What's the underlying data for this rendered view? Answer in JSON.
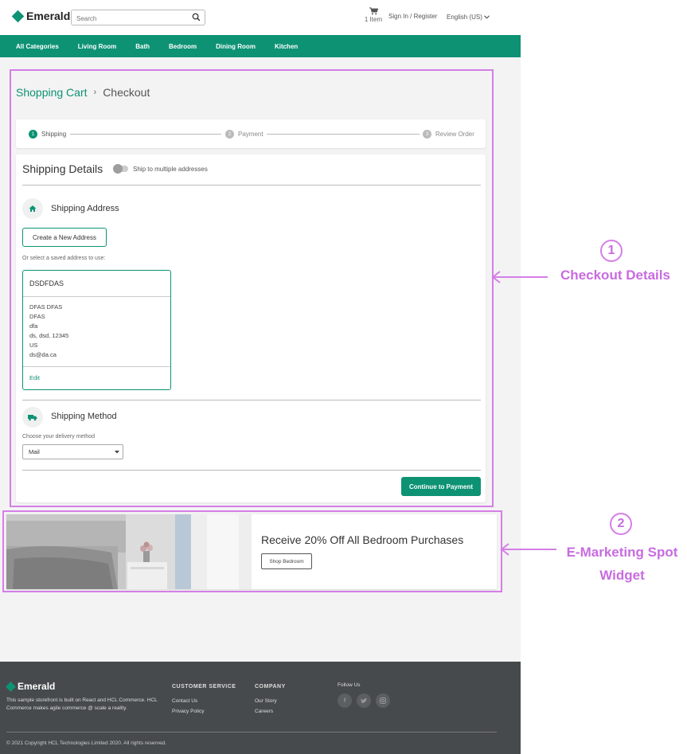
{
  "header": {
    "brand": "Emerald",
    "search_placeholder": "Search",
    "cart_count": "1 Item",
    "signin": "Sign In / Register",
    "language": "English (US)"
  },
  "nav": {
    "items": [
      "All Categories",
      "Living Room",
      "Bath",
      "Bedroom",
      "Dining Room",
      "Kitchen"
    ]
  },
  "breadcrumb": {
    "link": "Shopping Cart",
    "separator": "›",
    "current": "Checkout"
  },
  "stepper": {
    "steps": [
      {
        "num": "1",
        "label": "Shipping"
      },
      {
        "num": "2",
        "label": "Payment"
      },
      {
        "num": "3",
        "label": "Review Order"
      }
    ]
  },
  "shipping": {
    "title": "Shipping Details",
    "toggle_label": "Ship to multiple addresses",
    "address_title": "Shipping Address",
    "create_button": "Create a New Address",
    "saved_prompt": "Or select a saved address to use:",
    "saved_address": {
      "name": "DSDFDAS",
      "lines": [
        "DFAS DFAS",
        "DFAS",
        "dfa",
        "ds, dsd, 12345",
        "US",
        "ds@da.ca"
      ],
      "edit": "Edit"
    },
    "method_title": "Shipping Method",
    "method_prompt": "Choose your delivery method",
    "method_value": "Mail",
    "continue_button": "Continue to Payment"
  },
  "espot": {
    "title": "Receive 20% Off All Bedroom Purchases",
    "button": "Shop Bedroom"
  },
  "footer": {
    "brand": "Emerald",
    "description": "This sample storefront is built on React and HCL Commerce. HCL Commerce makes agile commerce @ scale a reality.",
    "customer_service": {
      "heading": "CUSTOMER SERVICE",
      "links": [
        "Contact Us",
        "Privacy Policy"
      ]
    },
    "company": {
      "heading": "COMPANY",
      "links": [
        "Our Story",
        "Careers"
      ]
    },
    "follow": "Follow Us",
    "copyright": "© 2021 Copyright HCL Technologies Limited 2020. All rights reserved."
  },
  "annotations": [
    {
      "num": "1",
      "label": "Checkout Details"
    },
    {
      "num": "2",
      "label": "E-Marketing Spot Widget"
    }
  ],
  "colors": {
    "brand": "#0d9274",
    "annotation": "#d47fe6",
    "footer_bg": "#464a4c"
  }
}
